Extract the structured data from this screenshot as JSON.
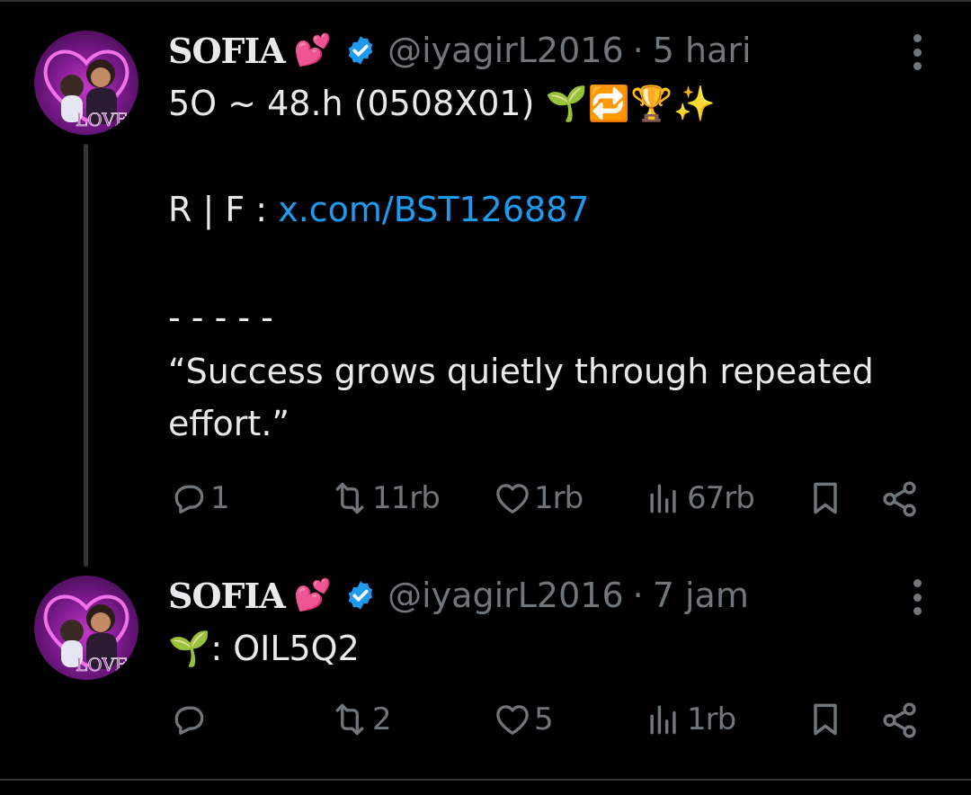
{
  "tweets": [
    {
      "author": {
        "name": "SOFIA",
        "emoji": "💕",
        "handle": "@iyagirL2016",
        "avatar_text": "LOVE"
      },
      "separator": "·",
      "time": "5 hari",
      "lines": {
        "line1_text": "5O ~ 48.h (0508X01)",
        "line1_emojis": "🌱🔁🏆✨",
        "line2_prefix": "R | F :",
        "line2_link": "x.com/BST126887",
        "line3": "- - - - -",
        "line4": "“Success grows quietly through repeated",
        "line5": "effort.”"
      },
      "stats": {
        "replies": "1",
        "reposts": "11rb",
        "likes": "1rb",
        "views": "67rb"
      }
    },
    {
      "author": {
        "name": "SOFIA",
        "emoji": "💕",
        "handle": "@iyagirL2016",
        "avatar_text": "LOVE"
      },
      "separator": "·",
      "time": "7 jam",
      "lines": {
        "line1_emoji": "🌱",
        "line1_text": ": OIL5Q2"
      },
      "stats": {
        "replies": "",
        "reposts": "2",
        "likes": "5",
        "views": "1rb"
      }
    }
  ],
  "theme": {
    "background": "#000000",
    "text": "#e7e9ea",
    "muted": "#71767b",
    "link": "#1d9bf0",
    "verified": "#1d9bf0"
  }
}
